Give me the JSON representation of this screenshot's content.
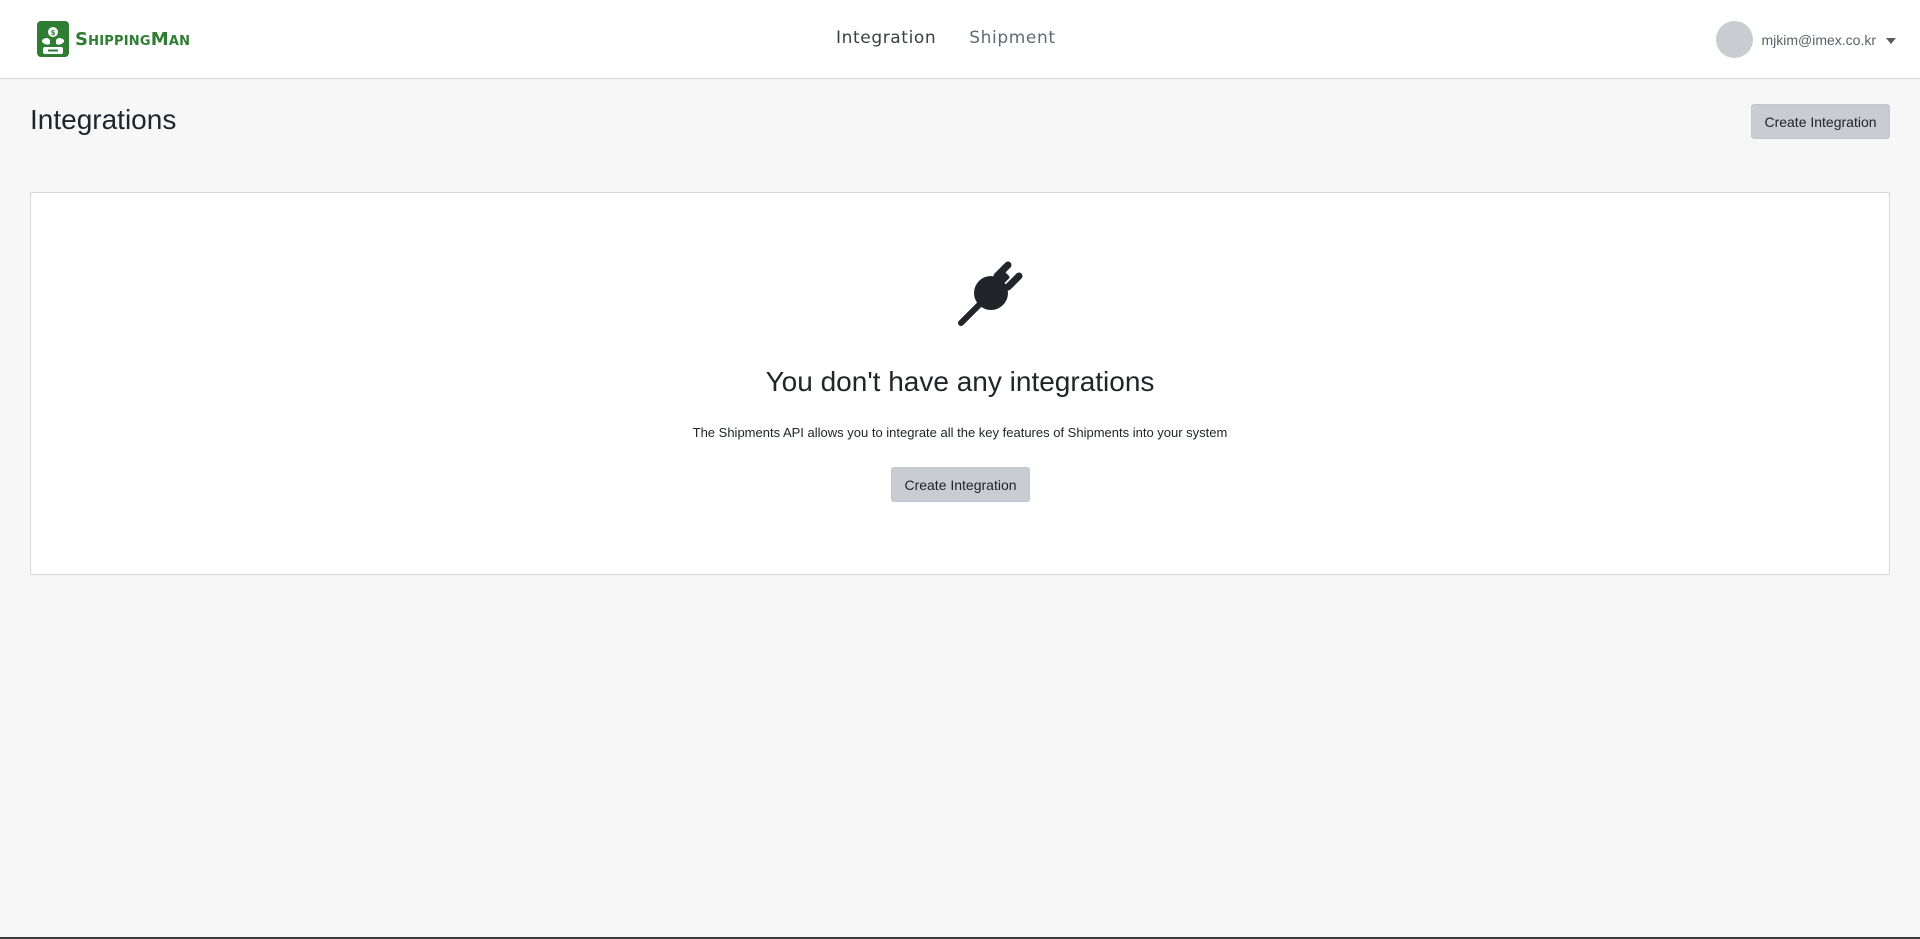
{
  "brand": {
    "name": "ShippingMan",
    "color": "#2e7d32"
  },
  "nav": {
    "items": [
      {
        "label": "Integration"
      },
      {
        "label": "Shipment"
      }
    ]
  },
  "user": {
    "email": "mjkim@imex.co.kr",
    "avatar_icon": "user-avatar-placeholder",
    "menu_icon": "caret-down"
  },
  "page": {
    "title": "Integrations",
    "create_button_label": "Create Integration"
  },
  "empty_state": {
    "icon": "plug-icon",
    "title": "You don't have any integrations",
    "description": "The Shipments API allows you to integrate all the key features of Shipments into your system",
    "button_label": "Create Integration"
  },
  "colors": {
    "button_bg": "#c9cdd3",
    "page_bg": "#f7f7f7"
  }
}
